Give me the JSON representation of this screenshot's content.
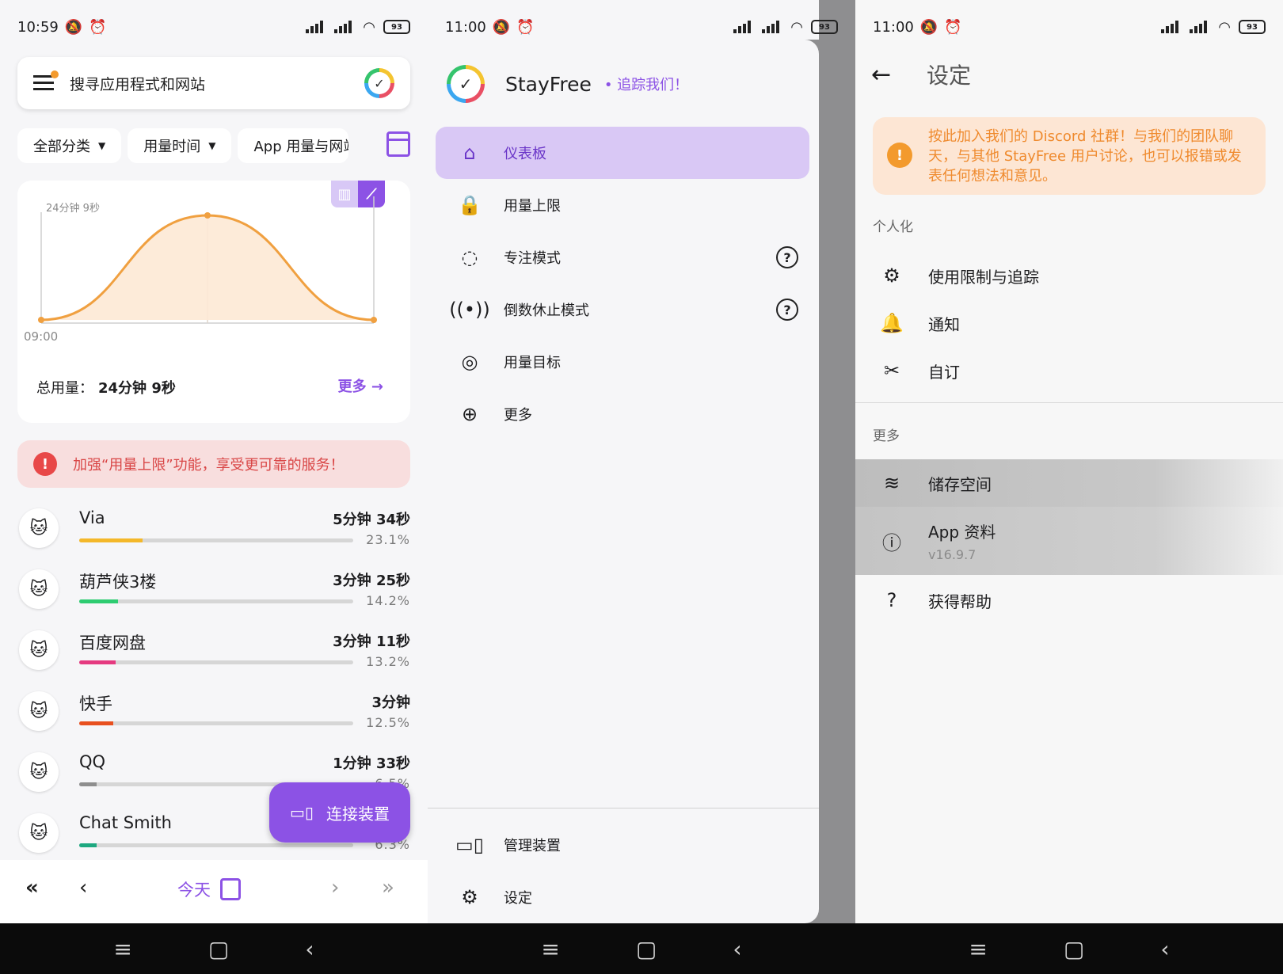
{
  "panel1": {
    "status": {
      "time": "10:59",
      "battery": "93"
    },
    "search": {
      "placeholder": "搜寻应用程式和网站"
    },
    "filters": [
      {
        "label": "全部分类"
      },
      {
        "label": "用量时间"
      },
      {
        "label": "App 用量与网站"
      }
    ],
    "chart_card": {
      "y_tick_label": "24分钟 9秒",
      "x_tick_label": "09:00",
      "total_label": "总用量：",
      "total_value": "24分钟 9秒",
      "more_label": "更多"
    },
    "alert": {
      "text": "加强“用量上限”功能，享受更可靠的服务！"
    },
    "apps": [
      {
        "name": "Via",
        "time": "5分钟 34秒",
        "pct": "23.1%",
        "fraction": 0.231,
        "color": "#f4b82a"
      },
      {
        "name": "葫芦侠3楼",
        "time": "3分钟 25秒",
        "pct": "14.2%",
        "fraction": 0.142,
        "color": "#2ecc71"
      },
      {
        "name": "百度网盘",
        "time": "3分钟 11秒",
        "pct": "13.2%",
        "fraction": 0.132,
        "color": "#e53a80"
      },
      {
        "name": "快手",
        "time": "3分钟",
        "pct": "12.5%",
        "fraction": 0.125,
        "color": "#e8501f"
      },
      {
        "name": "QQ",
        "time": "1分钟 33秒",
        "pct": "6.5%",
        "fraction": 0.065,
        "color": "#8e8e8e"
      },
      {
        "name": "Chat Smith",
        "time": "",
        "pct": "6.3%",
        "fraction": 0.063,
        "color": "#1ea880"
      }
    ],
    "fab_label": "连接装置",
    "bottom": {
      "today": "今天"
    }
  },
  "chart_data": {
    "type": "area",
    "x": [
      "09:00",
      "",
      ""
    ],
    "values": [
      0,
      24.15,
      0
    ],
    "ylabel": "",
    "xlabel": "",
    "series": [
      {
        "values": [
          0,
          24.15,
          0
        ]
      }
    ],
    "color": "#f0a040"
  },
  "panel2": {
    "status": {
      "time": "11:00",
      "battery": "93"
    },
    "app_name": "StayFree",
    "follow": "• 追踪我们！",
    "menu": [
      {
        "label": "仪表板",
        "icon": "home-icon"
      },
      {
        "label": "用量上限",
        "icon": "lock-clock-icon"
      },
      {
        "label": "专注模式",
        "icon": "focus-icon"
      },
      {
        "label": "倒数休止模式",
        "icon": "broadcast-icon"
      },
      {
        "label": "用量目标",
        "icon": "target-icon"
      },
      {
        "label": "更多",
        "icon": "download-circle-icon"
      }
    ],
    "bottom_menu": [
      {
        "label": "管理装置"
      },
      {
        "label": "设定"
      }
    ]
  },
  "panel3": {
    "status": {
      "time": "11:00",
      "battery": "93"
    },
    "title": "设定",
    "alert": "按此加入我们的 Discord 社群！与我们的团队聊天，与其他 StayFree 用户讨论，也可以报错或发表任何想法和意见。",
    "section_personal": "个人化",
    "personal_items": [
      {
        "label": "使用限制与追踪"
      },
      {
        "label": "通知"
      },
      {
        "label": "自订"
      }
    ],
    "section_more": "更多",
    "more_items": [
      {
        "label": "储存空间",
        "sub": ""
      },
      {
        "label": "App 资料",
        "sub": "v16.9.7"
      },
      {
        "label": "获得帮助",
        "sub": ""
      }
    ]
  },
  "colors": {
    "accent": "#8c52e5",
    "accent_light": "#d9c8f5",
    "alert_red": "#d94646",
    "alert_orange": "#ef8a2d"
  }
}
